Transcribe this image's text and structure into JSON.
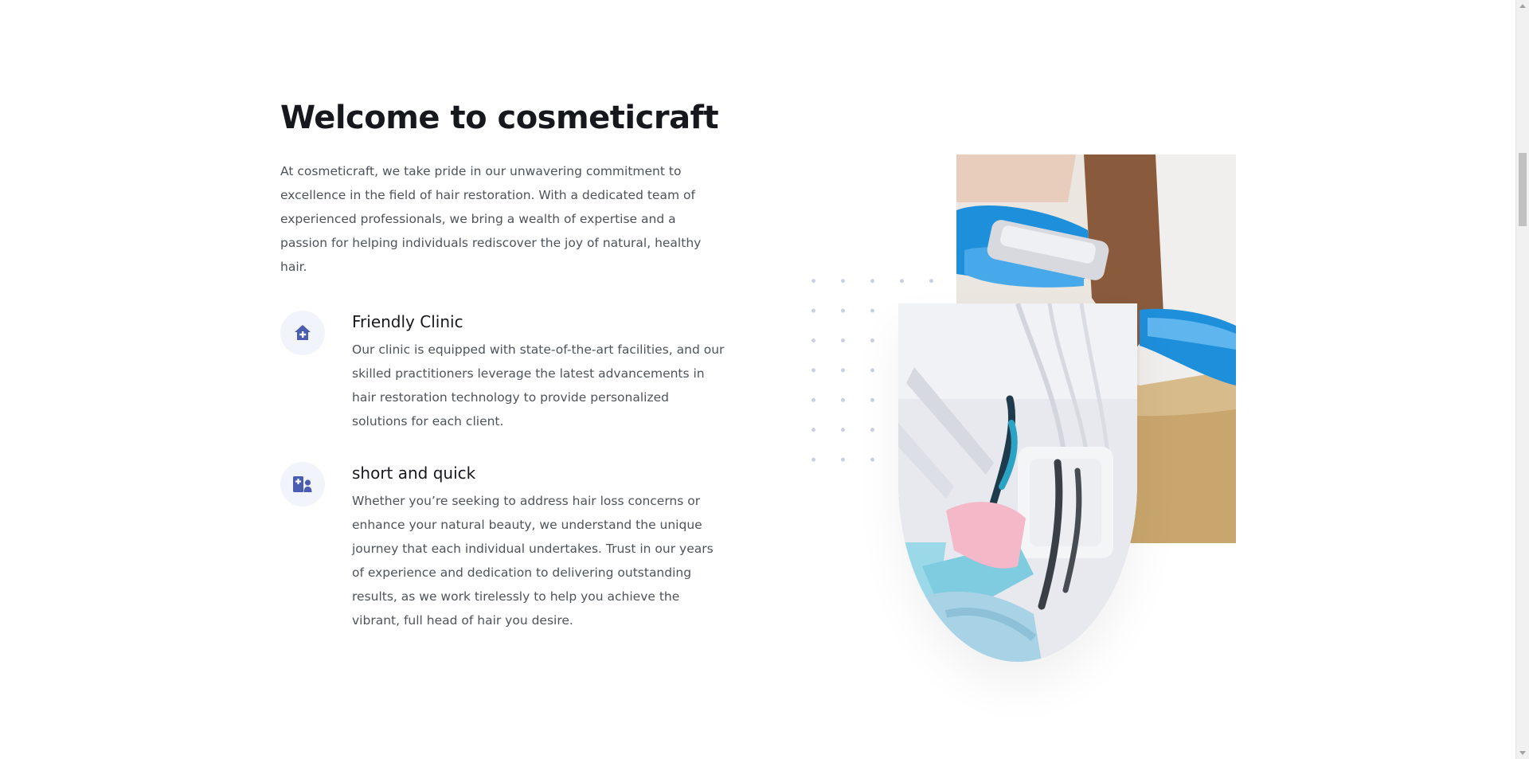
{
  "welcome": {
    "title": "Welcome to cosmeticraft",
    "intro": "At cosmeticraft, we take pride in our unwavering commitment to excellence in the field of hair restoration. With a dedicated team of experienced professionals, we bring a wealth of expertise and a passion for helping individuals rediscover the joy of natural, healthy hair."
  },
  "features": [
    {
      "icon": "house-medical-icon",
      "title": "Friendly Clinic",
      "text": "Our clinic is equipped with state-of-the-art facilities, and our skilled practitioners leverage the latest advancements in hair restoration technology to provide personalized solutions for each client."
    },
    {
      "icon": "hospital-user-icon",
      "title": "short and quick",
      "text": "Whether you’re seeking to address hair loss concerns or enhance your natural beauty, we understand the unique journey that each individual undertakes. Trust in our years of experience and dedication to delivering outstanding results, as we work tirelessly to help you achieve the vibrant, full head of hair you desire."
    }
  ],
  "images": {
    "rect": "hair-treatment-photo",
    "oval": "dental-instruments-photo"
  },
  "colors": {
    "icon": "#4a5db0",
    "icon_bg": "#f2f4fb",
    "heading": "#16181d",
    "body_text": "#4e535b"
  }
}
